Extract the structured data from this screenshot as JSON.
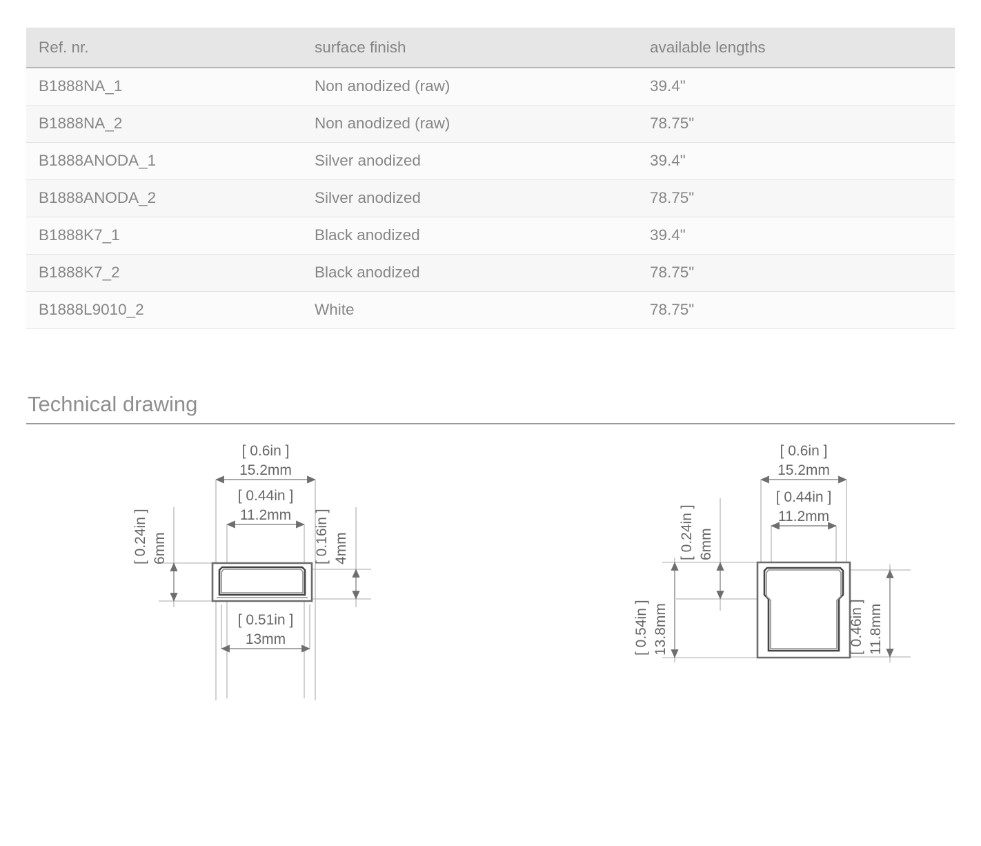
{
  "table": {
    "headers": [
      "Ref. nr.",
      "surface finish",
      "available lengths"
    ],
    "rows": [
      {
        "ref": "B1888NA_1",
        "finish": "Non anodized (raw)",
        "length": "39.4\""
      },
      {
        "ref": "B1888NA_2",
        "finish": "Non anodized (raw)",
        "length": "78.75\""
      },
      {
        "ref": "B1888ANODA_1",
        "finish": "Silver anodized",
        "length": "39.4\""
      },
      {
        "ref": "B1888ANODA_2",
        "finish": "Silver anodized",
        "length": "78.75\""
      },
      {
        "ref": "B1888K7_1",
        "finish": "Black anodized",
        "length": "39.4\""
      },
      {
        "ref": "B1888K7_2",
        "finish": "Black anodized",
        "length": "78.75\""
      },
      {
        "ref": "B1888L9010_2",
        "finish": "White",
        "length": "78.75\""
      }
    ]
  },
  "section": {
    "technical_drawing_title": "Technical drawing"
  },
  "drawings": {
    "left": {
      "top_outer_in": "[ 0.6in ]",
      "top_outer_mm": "15.2mm",
      "top_inner_in": "[ 0.44in ]",
      "top_inner_mm": "11.2mm",
      "left_height_in": "[ 0.24in ]",
      "left_height_mm": "6mm",
      "right_height_in": "[ 0.16in ]",
      "right_height_mm": "4mm",
      "bottom_in": "[ 0.51in ]",
      "bottom_mm": "13mm"
    },
    "right": {
      "top_outer_in": "[ 0.6in ]",
      "top_outer_mm": "15.2mm",
      "top_inner_in": "[ 0.44in ]",
      "top_inner_mm": "11.2mm",
      "mid_height_in": "[ 0.24in ]",
      "mid_height_mm": "6mm",
      "left_height_in": "[ 0.54in ]",
      "left_height_mm": "13.8mm",
      "right_height_in": "[ 0.46in ]",
      "right_height_mm": "11.8mm"
    }
  },
  "colors": {
    "header_bg": "#e6e6e6",
    "text": "#868686",
    "rule": "#9a9a9a"
  }
}
